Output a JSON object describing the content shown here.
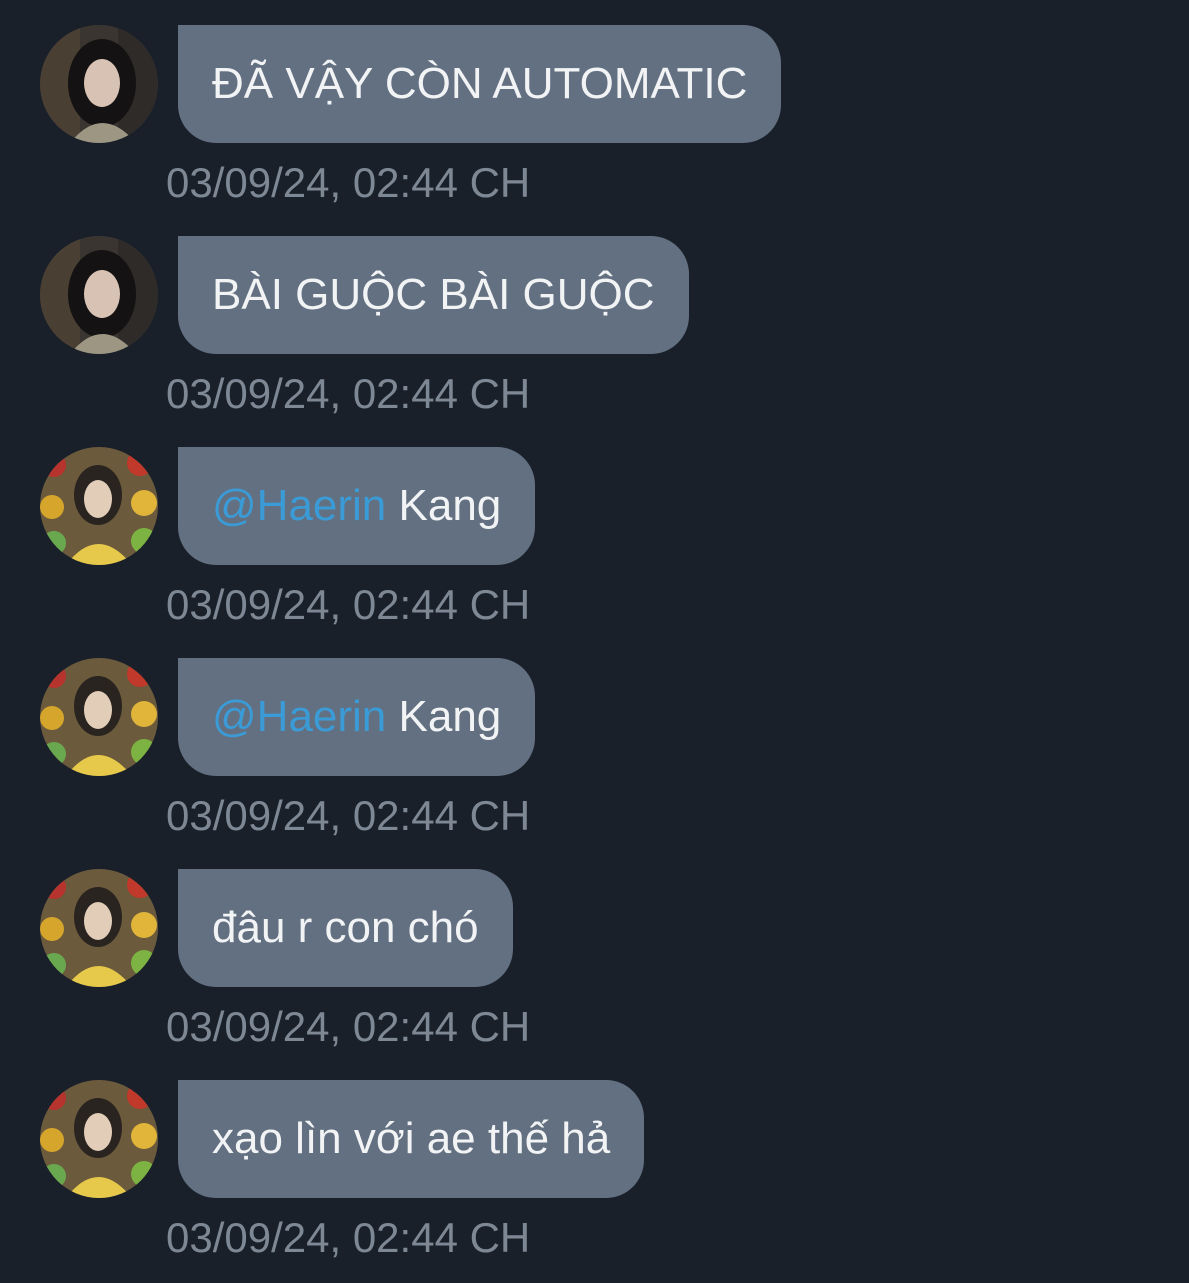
{
  "messages": [
    {
      "avatar": "dark-haired-girl-avatar",
      "mention": "",
      "text": "ĐÃ VẬY CÒN AUTOMATIC",
      "time": "03/09/24, 02:44 CH"
    },
    {
      "avatar": "dark-haired-girl-avatar",
      "mention": "",
      "text": "BÀI GUỘC BÀI GUỘC",
      "time": "03/09/24, 02:44 CH"
    },
    {
      "avatar": "girl-with-fruit-background-avatar",
      "mention": "@Haerin",
      "text": " Kang",
      "time": "03/09/24, 02:44 CH"
    },
    {
      "avatar": "girl-with-fruit-background-avatar",
      "mention": "@Haerin",
      "text": " Kang",
      "time": "03/09/24, 02:44 CH"
    },
    {
      "avatar": "girl-with-fruit-background-avatar",
      "mention": "",
      "text": "đâu r con chó",
      "time": "03/09/24, 02:44 CH"
    },
    {
      "avatar": "girl-with-fruit-background-avatar",
      "mention": "",
      "text": "xạo lìn với ae thế hả",
      "time": "03/09/24, 02:44 CH"
    }
  ],
  "colors": {
    "background": "#19202a",
    "bubble": "#637081",
    "message_text": "#f1f3f5",
    "mention": "#3a9bd6",
    "timestamp": "#7e8894"
  }
}
